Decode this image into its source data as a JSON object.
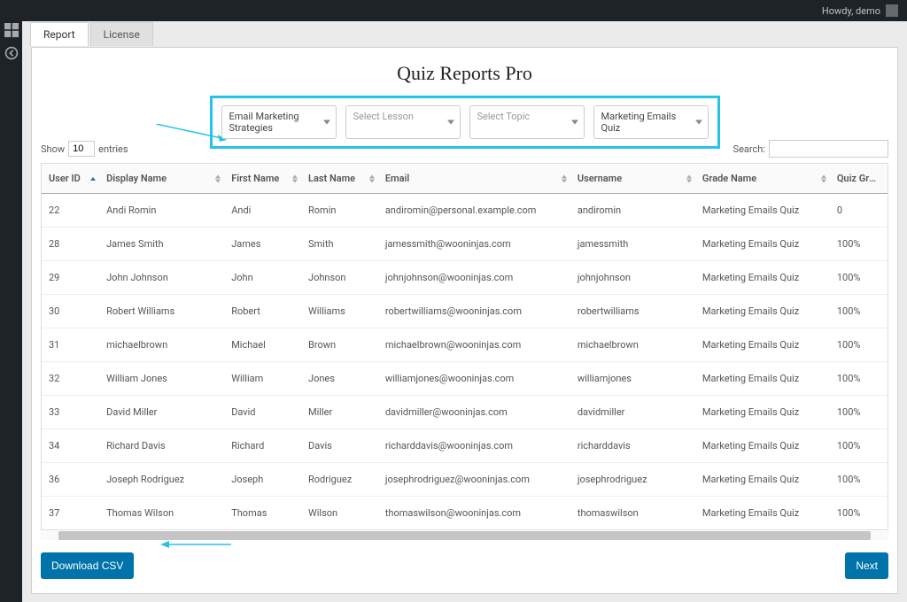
{
  "topbar": {
    "howdy": "Howdy, demo"
  },
  "tabs": {
    "report": "Report",
    "license": "License"
  },
  "page_title": "Quiz Reports Pro",
  "filters": {
    "course": "Email Marketing Strategies",
    "lesson_placeholder": "Select Lesson",
    "topic_placeholder": "Select Topic",
    "quiz": "Marketing Emails Quiz"
  },
  "table_ctrl": {
    "show": "Show",
    "entries_value": "10",
    "entries": "entries",
    "search": "Search:"
  },
  "columns": {
    "user_id": "User ID",
    "display_name": "Display Name",
    "first_name": "First Name",
    "last_name": "Last Name",
    "email": "Email",
    "username": "Username",
    "grade_name": "Grade Name",
    "quiz_grade_score": "Quiz Grade Score"
  },
  "rows": [
    {
      "user_id": "22",
      "display_name": "Andi Romin",
      "first_name": "Andi",
      "last_name": "Romin",
      "email": "andiromin@personal.example.com",
      "username": "andiromin",
      "grade_name": "Marketing Emails Quiz",
      "score": "0"
    },
    {
      "user_id": "28",
      "display_name": "James Smith",
      "first_name": "James",
      "last_name": "Smith",
      "email": "jamessmith@wooninjas.com",
      "username": "jamessmith",
      "grade_name": "Marketing Emails Quiz",
      "score": "100%"
    },
    {
      "user_id": "29",
      "display_name": "John Johnson",
      "first_name": "John",
      "last_name": "Johnson",
      "email": "johnjohnson@wooninjas.com",
      "username": "johnjohnson",
      "grade_name": "Marketing Emails Quiz",
      "score": "100%"
    },
    {
      "user_id": "30",
      "display_name": "Robert Williams",
      "first_name": "Robert",
      "last_name": "Williams",
      "email": "robertwilliams@wooninjas.com",
      "username": "robertwilliams",
      "grade_name": "Marketing Emails Quiz",
      "score": "100%"
    },
    {
      "user_id": "31",
      "display_name": "michaelbrown",
      "first_name": "Michael",
      "last_name": "Brown",
      "email": "michaelbrown@wooninjas.com",
      "username": "michaelbrown",
      "grade_name": "Marketing Emails Quiz",
      "score": "100%"
    },
    {
      "user_id": "32",
      "display_name": "William Jones",
      "first_name": "William",
      "last_name": "Jones",
      "email": "williamjones@wooninjas.com",
      "username": "williamjones",
      "grade_name": "Marketing Emails Quiz",
      "score": "100%"
    },
    {
      "user_id": "33",
      "display_name": "David Miller",
      "first_name": "David",
      "last_name": "Miller",
      "email": "davidmiller@wooninjas.com",
      "username": "davidmiller",
      "grade_name": "Marketing Emails Quiz",
      "score": "100%"
    },
    {
      "user_id": "34",
      "display_name": "Richard Davis",
      "first_name": "Richard",
      "last_name": "Davis",
      "email": "richarddavis@wooninjas.com",
      "username": "richarddavis",
      "grade_name": "Marketing Emails Quiz",
      "score": "100%"
    },
    {
      "user_id": "36",
      "display_name": "Joseph Rodriguez",
      "first_name": "Joseph",
      "last_name": "Rodriguez",
      "email": "josephrodriguez@wooninjas.com",
      "username": "josephrodriguez",
      "grade_name": "Marketing Emails Quiz",
      "score": "100%"
    },
    {
      "user_id": "37",
      "display_name": "Thomas Wilson",
      "first_name": "Thomas",
      "last_name": "Wilson",
      "email": "thomaswilson@wooninjas.com",
      "username": "thomaswilson",
      "grade_name": "Marketing Emails Quiz",
      "score": "100%"
    }
  ],
  "buttons": {
    "download_csv": "Download CSV",
    "next": "Next"
  },
  "colors": {
    "highlight": "#25c3e6",
    "primary": "#0073aa"
  }
}
